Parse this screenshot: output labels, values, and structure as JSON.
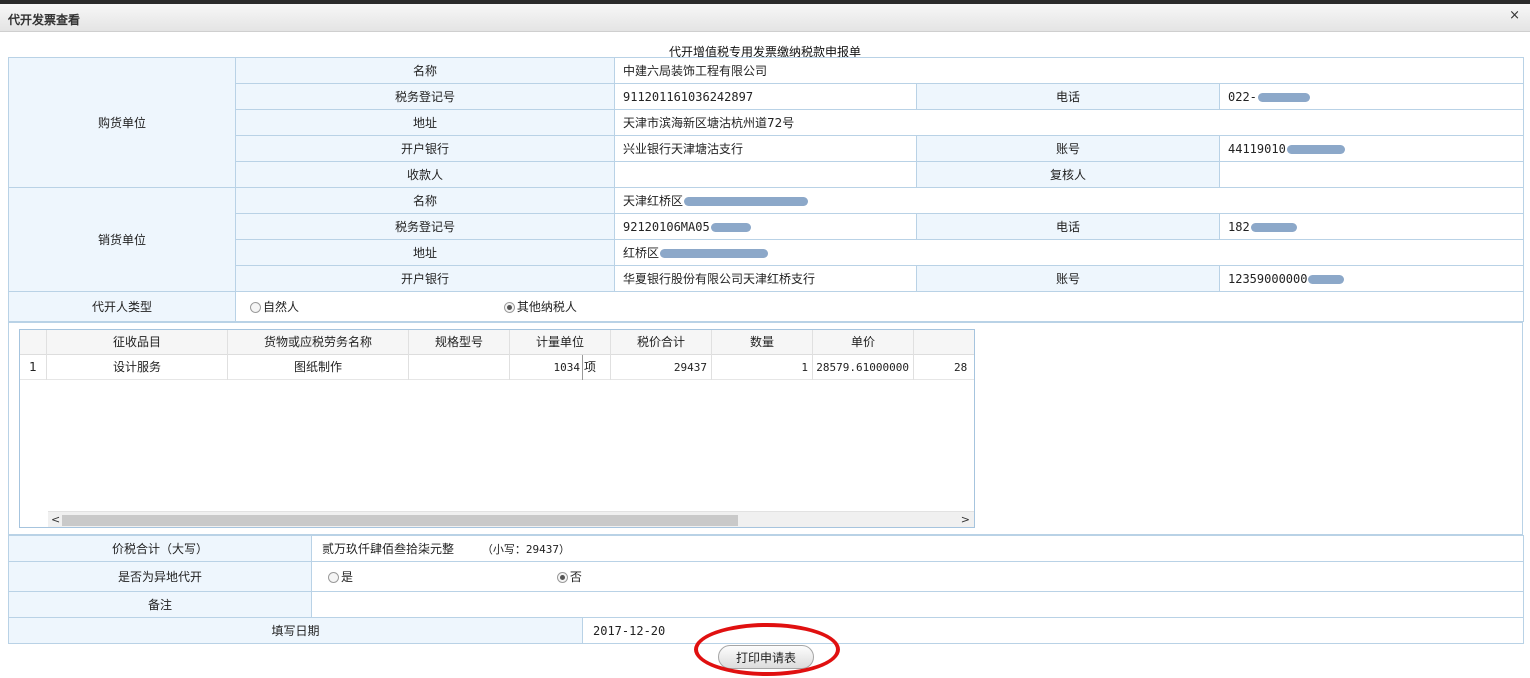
{
  "window": {
    "title": "代开发票查看",
    "close_glyph": "×"
  },
  "form_title": "代开增值税专用发票缴纳税款申报单",
  "buyer": {
    "section_label": "购货单位",
    "name_label": "名称",
    "name": "中建六局装饰工程有限公司",
    "tax_id_label": "税务登记号",
    "tax_id": "911201161036242897",
    "phone_label": "电话",
    "phone": "022-",
    "address_label": "地址",
    "address": "天津市滨海新区塘沽杭州道72号",
    "bank_label": "开户银行",
    "bank": "兴业银行天津塘沽支行",
    "account_label": "账号",
    "account": "44119010",
    "payee_label": "收款人",
    "payee": "",
    "reviewer_label": "复核人",
    "reviewer": ""
  },
  "seller": {
    "section_label": "销货单位",
    "name_label": "名称",
    "name": "天津红桥区",
    "tax_id_label": "税务登记号",
    "tax_id": "92120106MA05",
    "phone_label": "电话",
    "phone": "182",
    "address_label": "地址",
    "address": "红桥区",
    "bank_label": "开户银行",
    "bank": "华夏银行股份有限公司天津红桥支行",
    "account_label": "账号",
    "account": "12359000000"
  },
  "agent_type": {
    "label": "代开人类型",
    "options": [
      "自然人",
      "其他纳税人"
    ],
    "selected": "其他纳税人"
  },
  "items": {
    "columns": [
      "征收品目",
      "货物或应税劳务名称",
      "规格型号",
      "计量单位",
      "税价合计",
      "数量",
      "单价"
    ],
    "rows": [
      {
        "index": "1",
        "category": "设计服务",
        "goods_name": "图纸制作",
        "spec": "",
        "unit_code": "1034",
        "unit": "项",
        "total": "29437",
        "quantity": "1",
        "unit_price": "28579.61000000",
        "overflow": "28"
      }
    ]
  },
  "total": {
    "label": "价税合计（大写）",
    "value": "贰万玖仟肆佰叁拾柒元整",
    "small_value": "（小写：29437）"
  },
  "remote": {
    "label": "是否为异地代开",
    "options": [
      "是",
      "否"
    ],
    "selected": "否"
  },
  "remark": {
    "label": "备注",
    "value": ""
  },
  "date": {
    "label": "填写日期",
    "value": "2017-12-20"
  },
  "print_button": {
    "label": "打印申请表"
  }
}
